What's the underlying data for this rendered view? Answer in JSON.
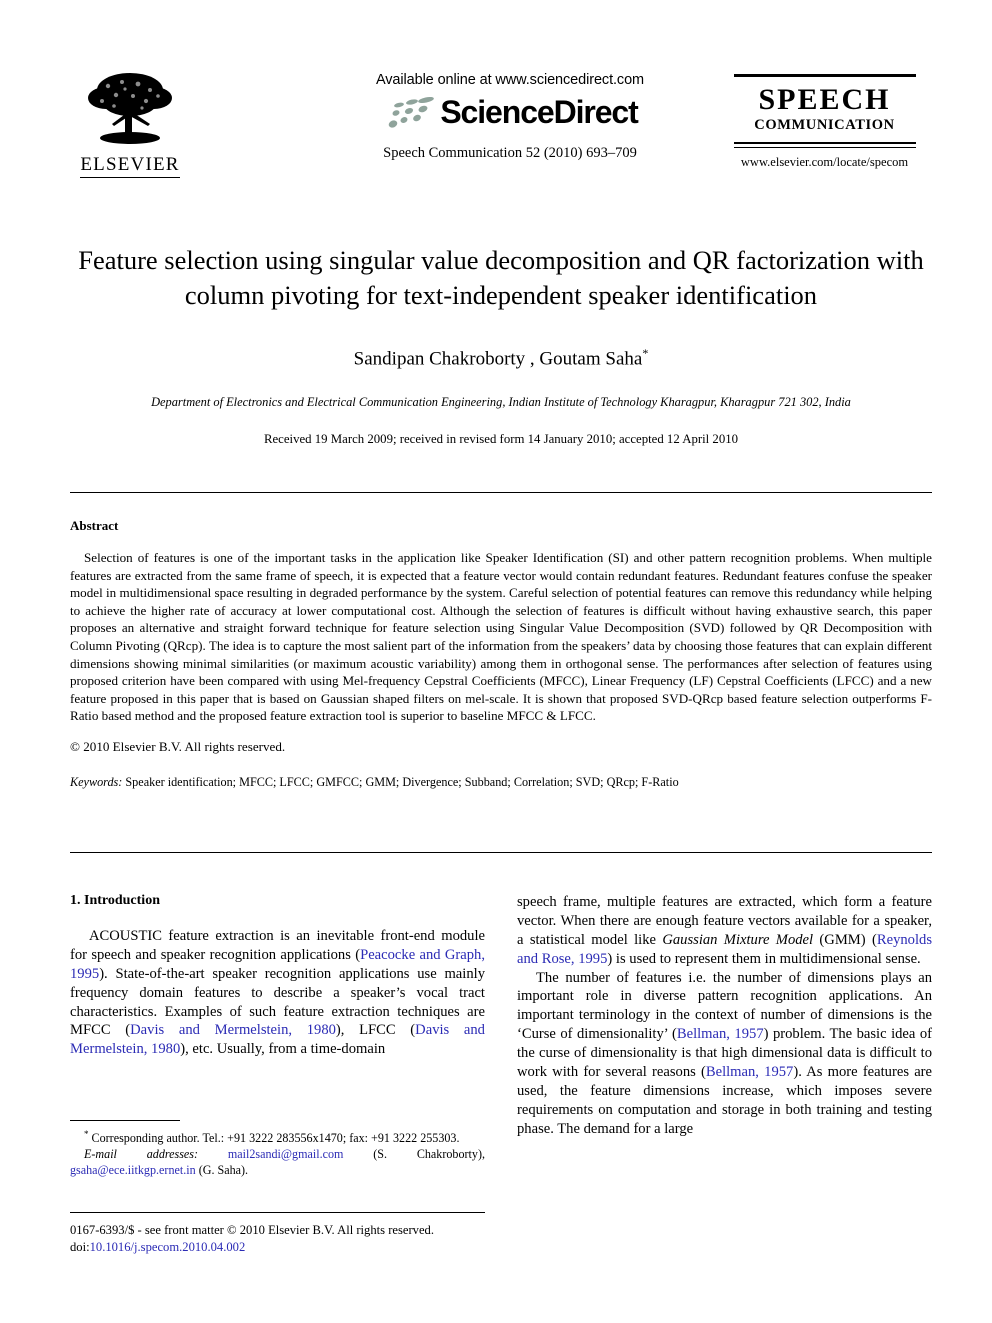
{
  "masthead": {
    "publisher_name": "ELSEVIER",
    "available_online": "Available online at www.sciencedirect.com",
    "sciencedirect_wordmark": "ScienceDirect",
    "journal_reference": "Speech Communication 52 (2010) 693–709",
    "journal_title": "SPEECH",
    "journal_subtitle": "COMMUNICATION",
    "journal_url": "www.elsevier.com/locate/specom"
  },
  "article": {
    "title": "Feature selection using singular value decomposition and QR factorization with column pivoting for text-independent speaker identification",
    "authors": "Sandipan Chakroborty , Goutam Saha",
    "author_star": "*",
    "affiliation": "Department of Electronics and Electrical Communication Engineering, Indian Institute of Technology Kharagpur, Kharagpur 721 302, India",
    "history": "Received 19 March 2009; received in revised form 14 January 2010; accepted 12 April 2010"
  },
  "abstract": {
    "heading": "Abstract",
    "body": "Selection of features is one of the important tasks in the application like Speaker Identification (SI) and other pattern recognition problems. When multiple features are extracted from the same frame of speech, it is expected that a feature vector would contain redundant features. Redundant features confuse the speaker model in multidimensional space resulting in degraded performance by the system. Careful selection of potential features can remove this redundancy while helping to achieve the higher rate of accuracy at lower computational cost. Although the selection of features is difficult without having exhaustive search, this paper proposes an alternative and straight forward technique for feature selection using Singular Value Decomposition (SVD) followed by QR Decomposition with Column Pivoting (QRcp). The idea is to capture the most salient part of the information from the speakers’ data by choosing those features that can explain different dimensions showing minimal similarities (or maximum acoustic variability) among them in orthogonal sense. The performances after selection of features using proposed criterion have been compared with using Mel-frequency Cepstral Coefficients (MFCC), Linear Frequency (LF) Cepstral Coefficients (LFCC) and a new feature proposed in this paper that is based on Gaussian shaped filters on mel-scale. It is shown that proposed SVD-QRcp based feature selection outperforms F-Ratio based method and the proposed feature extraction tool is superior to baseline MFCC & LFCC.",
    "body_italic_token": "F",
    "copyright": "© 2010 Elsevier B.V. All rights reserved."
  },
  "keywords": {
    "label": "Keywords:",
    "text": "Speaker identification; MFCC; LFCC; GMFCC; GMM; Divergence; Subband; Correlation; SVD; QRcp; F-Ratio"
  },
  "body": {
    "section_heading": "1. Introduction",
    "left_paragraph_1": {
      "seg1": "ACOUSTIC feature extraction is an inevitable front-end module for speech and speaker recognition applications (",
      "cite1": "Peacocke and Graph, 1995",
      "seg2": "). State-of-the-art speaker recognition applications use mainly frequency domain features to describe a speaker’s vocal tract characteristics. Examples of such feature extraction techniques are MFCC (",
      "cite2": "Davis and Mermelstein, 1980",
      "seg3": "), LFCC (",
      "cite3": "Davis and Mermelstein, 1980",
      "seg4": "), etc. Usually, from a time-domain"
    },
    "right_paragraph_1": {
      "seg1": "speech frame, multiple features are extracted, which form a feature vector. When there are enough feature vectors available for a speaker, a statistical model like ",
      "italic1": "Gaussian Mixture Model",
      "seg2": " (GMM) (",
      "cite1": "Reynolds and Rose, 1995",
      "seg3": ") is used to represent them in multidimensional sense."
    },
    "right_paragraph_2": {
      "seg1": "The number of features i.e. the number of dimensions plays an important role in diverse pattern recognition applications. An important terminology in the context of number of dimensions is the ‘Curse of dimensionality’ (",
      "cite1": "Bellman, 1957",
      "seg2": ") problem. The basic idea of the curse of dimensionality is that high dimensional data is difficult to work with for several reasons (",
      "cite2": "Bellman, 1957",
      "seg3": "). As more features are used, the feature dimensions increase, which imposes severe requirements on computation and storage in both training and testing phase. The demand for a large"
    }
  },
  "footnotes": {
    "corresponding_marker": "*",
    "corresponding": "Corresponding author. Tel.: +91 3222 283556x1470; fax: +91 3222 255303.",
    "email_label": "E-mail addresses:",
    "email_1": "mail2sandi@gmail.com",
    "email_1_owner": "(S. Chakroborty),",
    "email_2": "gsaha@ece.iitkgp.ernet.in",
    "email_2_owner": "(G. Saha)."
  },
  "footer": {
    "issn_line": "0167-6393/$ - see front matter © 2010 Elsevier B.V. All rights reserved.",
    "doi_label": "doi:",
    "doi_value": "10.1016/j.specom.2010.04.002"
  },
  "colors": {
    "link": "#2b2bb5",
    "text": "#000000",
    "sd_dots": "#8fa39b"
  }
}
